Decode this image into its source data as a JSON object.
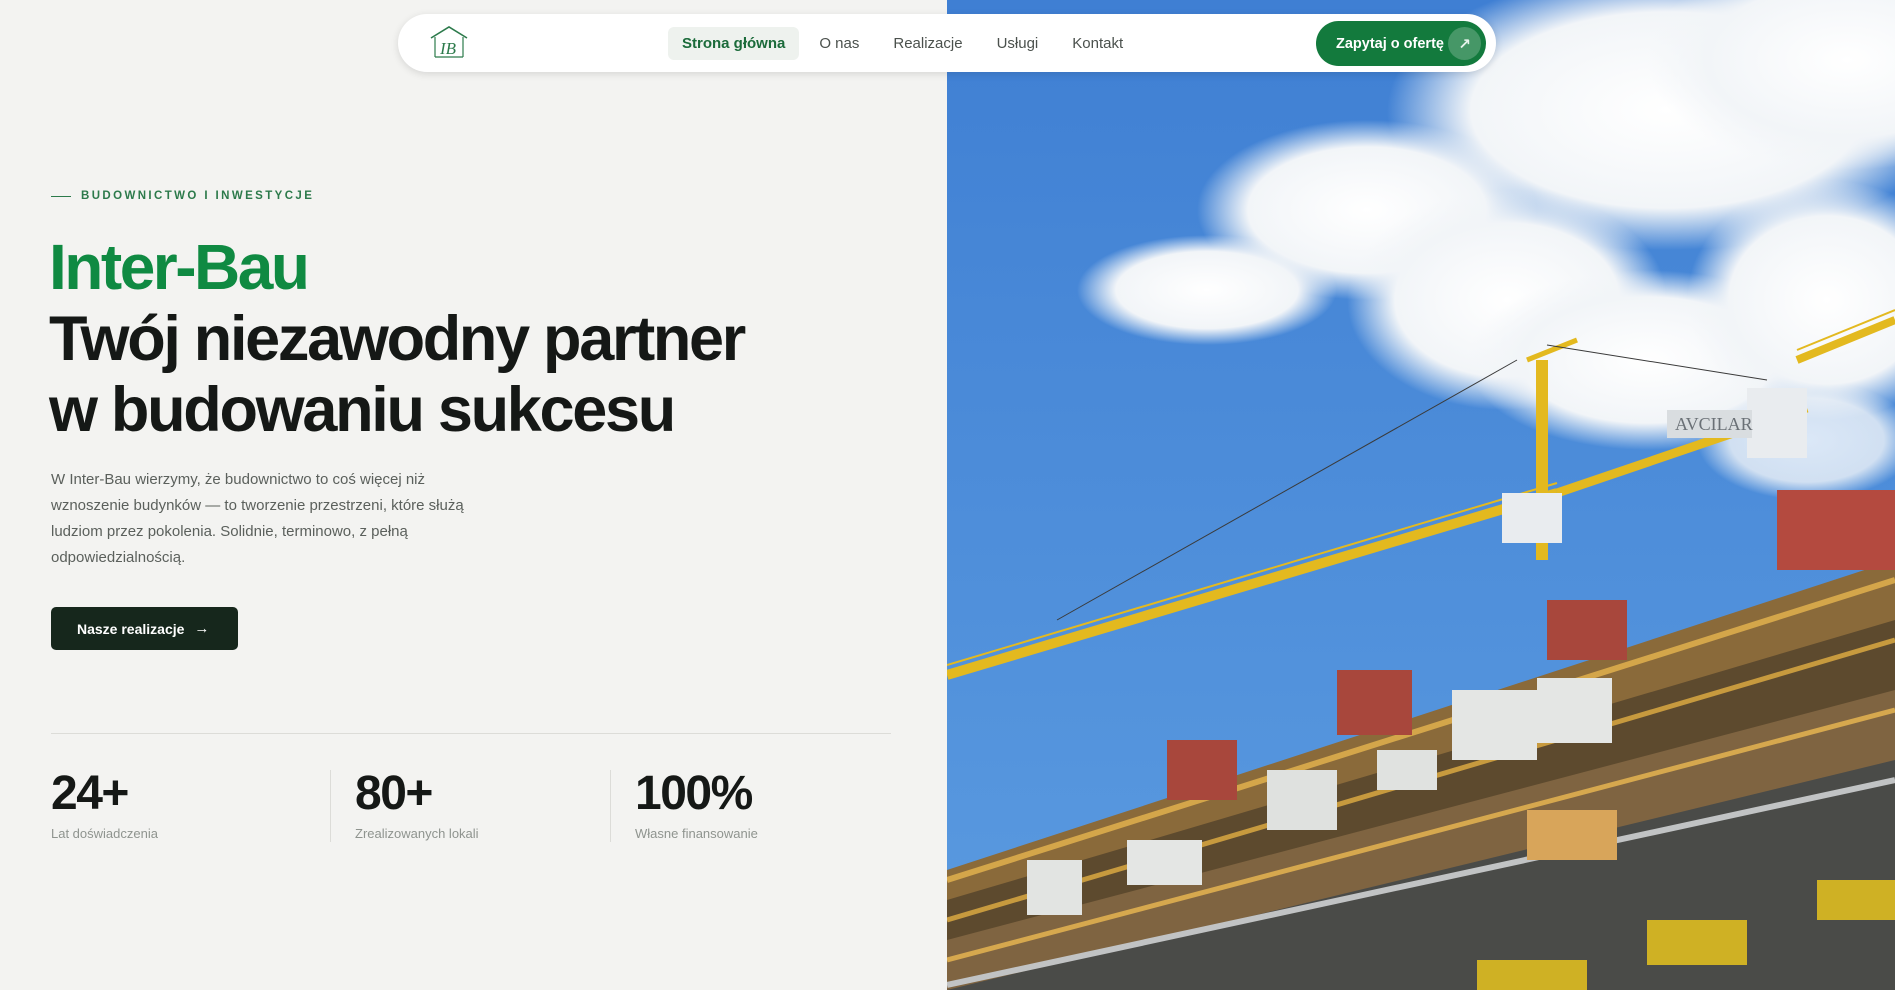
{
  "nav": {
    "logo_text": "IB",
    "links": [
      {
        "label": "Strona główna",
        "active": true
      },
      {
        "label": "O nas",
        "active": false
      },
      {
        "label": "Realizacje",
        "active": false
      },
      {
        "label": "Usługi",
        "active": false
      },
      {
        "label": "Kontakt",
        "active": false
      }
    ],
    "cta_label": "Zapytaj o ofertę",
    "cta_icon": "arrow-up-right-icon"
  },
  "hero": {
    "eyebrow": "BUDOWNICTWO I INWESTYCJE",
    "brand": "Inter-Bau",
    "headline_line1": "Twój niezawodny partner",
    "headline_line2": "w budowaniu sukcesu",
    "description": "W Inter-Bau wierzymy, że budownictwo to coś więcej niż wznoszenie budynków — to tworzenie przestrzeni, które służą ludziom przez pokolenia. Solidnie, terminowo, z pełną odpowiedzialnością.",
    "button_label": "Nasze realizacje",
    "button_icon": "arrow-right-icon"
  },
  "stats": [
    {
      "value": "24+",
      "label": "Lat doświadczenia"
    },
    {
      "value": "80+",
      "label": "Zrealizowanych lokali"
    },
    {
      "value": "100%",
      "label": "Własne finansowanie"
    }
  ],
  "image": {
    "description_icon": "construction-photo",
    "sign_text": "AVCILAR"
  },
  "colors": {
    "brand_green": "#0f8a42",
    "cta_green": "#137a3d",
    "dark_button": "#16271c",
    "background": "#f3f3f1"
  }
}
